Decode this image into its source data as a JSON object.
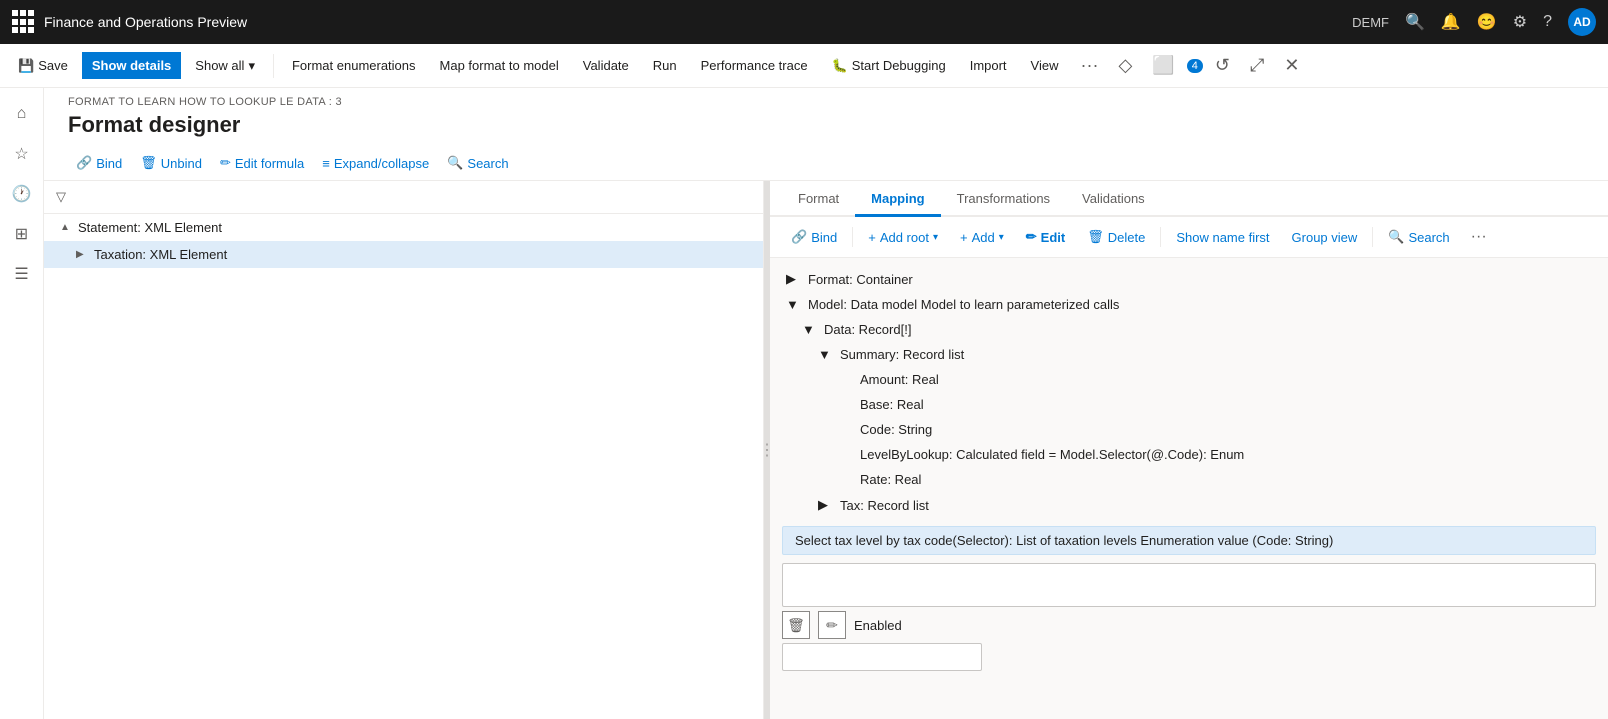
{
  "titleBar": {
    "appTitle": "Finance and Operations Preview",
    "env": "DEMF",
    "avatar": "AD"
  },
  "commandBar": {
    "save": "Save",
    "showDetails": "Show details",
    "showAll": "Show all",
    "showAllChevron": "▾",
    "formatEnumerations": "Format enumerations",
    "mapFormatToModel": "Map format to model",
    "validate": "Validate",
    "run": "Run",
    "performanceTrace": "Performance trace",
    "startDebugging": "Start Debugging",
    "import": "Import",
    "view": "View"
  },
  "pageHeader": {
    "breadcrumb": "FORMAT TO LEARN HOW TO LOOKUP LE DATA : 3",
    "title": "Format designer"
  },
  "leftToolbar": {
    "bind": "Bind",
    "unbind": "Unbind",
    "editFormula": "Edit formula",
    "expandCollapse": "Expand/collapse",
    "search": "Search"
  },
  "leftTree": {
    "items": [
      {
        "label": "Statement: XML Element",
        "level": 0,
        "expanded": true,
        "icon": "▲"
      },
      {
        "label": "Taxation: XML Element",
        "level": 1,
        "expanded": false,
        "icon": "▶",
        "selected": true
      }
    ]
  },
  "tabs": [
    {
      "label": "Format",
      "active": false
    },
    {
      "label": "Mapping",
      "active": true
    },
    {
      "label": "Transformations",
      "active": false
    },
    {
      "label": "Validations",
      "active": false
    }
  ],
  "mappingToolbar": {
    "bind": "Bind",
    "addRoot": "Add root",
    "addRootChevron": "▾",
    "add": "Add",
    "addChevron": "▾",
    "edit": "Edit",
    "delete": "Delete",
    "showNameFirst": "Show name first",
    "groupView": "Group view",
    "search": "Search"
  },
  "modelTree": {
    "items": [
      {
        "label": "Format: Container",
        "level": 0,
        "expanded": false,
        "icon": "▶"
      },
      {
        "label": "Model: Data model Model to learn parameterized calls",
        "level": 0,
        "expanded": true,
        "icon": "▼"
      },
      {
        "label": "Data: Record[!]",
        "level": 1,
        "expanded": true,
        "icon": "▼"
      },
      {
        "label": "Summary: Record list",
        "level": 2,
        "expanded": true,
        "icon": "▼"
      },
      {
        "label": "Amount: Real",
        "level": 3,
        "expanded": false,
        "icon": ""
      },
      {
        "label": "Base: Real",
        "level": 3,
        "expanded": false,
        "icon": ""
      },
      {
        "label": "Code: String",
        "level": 3,
        "expanded": false,
        "icon": ""
      },
      {
        "label": "LevelByLookup: Calculated field = Model.Selector(@.Code): Enum",
        "level": 3,
        "expanded": false,
        "icon": ""
      },
      {
        "label": "Rate: Real",
        "level": 3,
        "expanded": false,
        "icon": ""
      },
      {
        "label": "Tax: Record list",
        "level": 2,
        "expanded": false,
        "icon": "▶"
      }
    ]
  },
  "selectedMapping": {
    "text": "Select tax level by tax code(Selector): List of taxation levels Enumeration value (Code: String)"
  },
  "enabledRow": {
    "label": "Enabled"
  }
}
